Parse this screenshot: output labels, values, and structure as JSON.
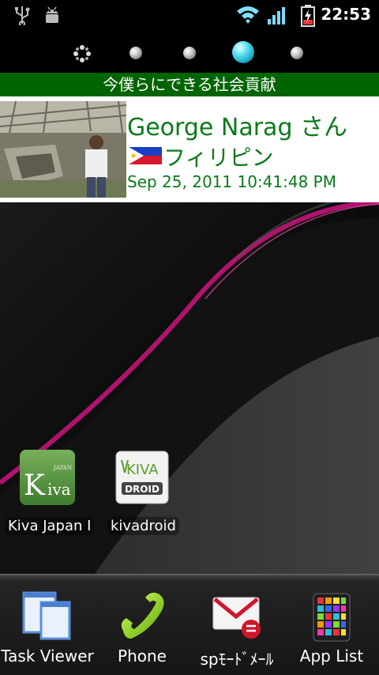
{
  "status_bar": {
    "time": "22:53",
    "icons": [
      "usb-icon",
      "android-debug-icon",
      "wifi-icon",
      "signal-icon",
      "battery-charging-icon"
    ]
  },
  "pager": {
    "pages": 5,
    "active_page": 4
  },
  "widget": {
    "header": "今僕らにできる社会貢献",
    "name": "George Narag さん",
    "country": "フィリピン",
    "date": "Sep 25, 2011 10:41:48 PM",
    "flag": "philippines-flag",
    "colors": {
      "header_bg": "#006400",
      "text": "#0a7a1a"
    }
  },
  "desktop_apps": [
    {
      "label": "Kiva Japan I",
      "icon": "kiva-japan-icon"
    },
    {
      "label": "kivadroid",
      "icon": "kivadroid-icon"
    }
  ],
  "dock": [
    {
      "label": "Task Viewer",
      "icon": "task-viewer-icon"
    },
    {
      "label": "Phone",
      "icon": "phone-icon"
    },
    {
      "label": "spﾓｰﾄﾞﾒｰﾙ",
      "icon": "sp-mail-icon"
    },
    {
      "label": "App List",
      "icon": "app-list-icon"
    }
  ],
  "kiva_icon_text": {
    "japan": "JAPAN",
    "k": "K",
    "iva": "iva",
    "kiva": "KIVA",
    "droid": "DROID"
  }
}
